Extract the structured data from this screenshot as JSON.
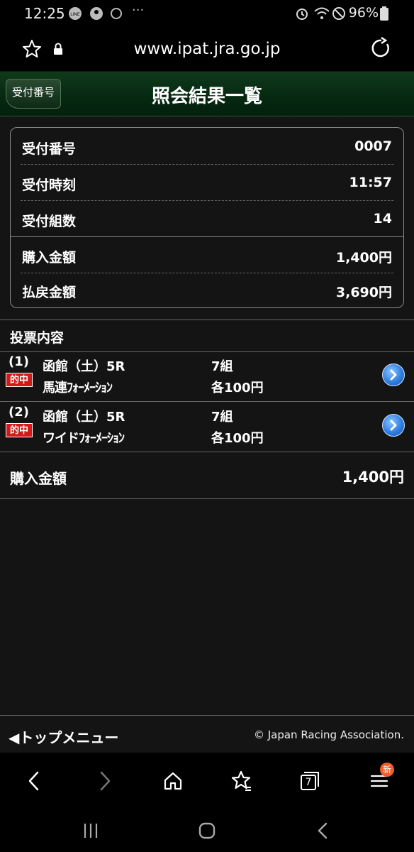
{
  "status_bar": {
    "time": "12:25",
    "battery": "96%"
  },
  "browser": {
    "url": "www.ipat.jra.go.jp",
    "tab_count": "7",
    "new_badge": "新"
  },
  "header": {
    "back_label": "受付番号",
    "title": "照会結果一覧"
  },
  "summary": {
    "rows": [
      {
        "label": "受付番号",
        "value": "0007"
      },
      {
        "label": "受付時刻",
        "value": "11:57"
      },
      {
        "label": "受付組数",
        "value": "14"
      },
      {
        "label": "購入金額",
        "value": "1,400円"
      },
      {
        "label": "払戻金額",
        "value": "3,690円"
      }
    ]
  },
  "votes": {
    "heading": "投票内容",
    "items": [
      {
        "num": "(1)",
        "badge": "的中",
        "race": "函館（土）5R",
        "type": "馬連ﾌｫｰﾒｰｼｮﾝ",
        "combos": "7組",
        "each": "各100円"
      },
      {
        "num": "(2)",
        "badge": "的中",
        "race": "函館（土）5R",
        "type": "ワイドﾌｫｰﾒｰｼｮﾝ",
        "combos": "7組",
        "each": "各100円"
      }
    ]
  },
  "total": {
    "label": "購入金額",
    "value": "1,400円"
  },
  "footer": {
    "menu_label": "◀トップメニュー",
    "copyright": "© Japan Racing Association."
  }
}
